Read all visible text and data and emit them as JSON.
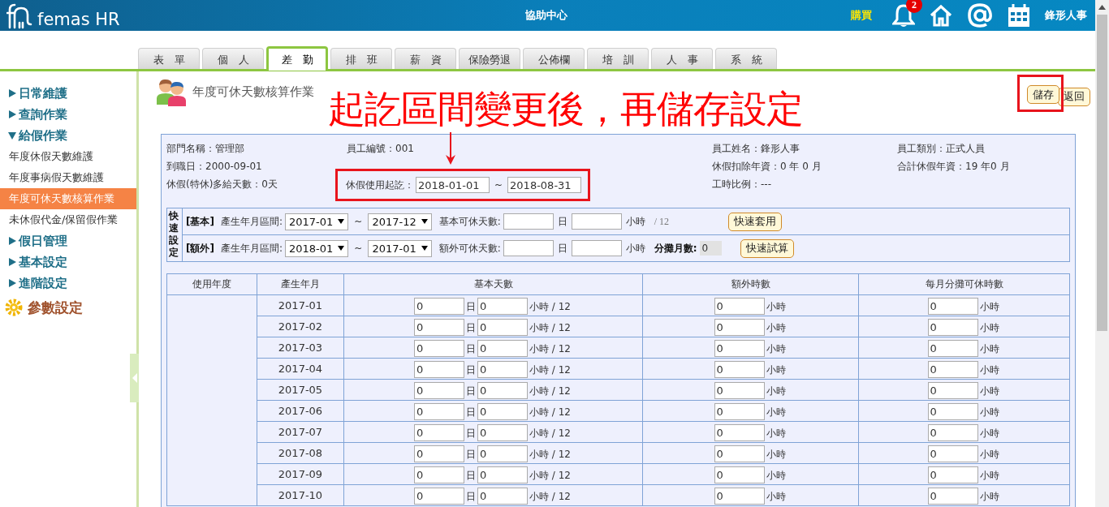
{
  "header": {
    "logo": "femas HR",
    "help": "協助中心",
    "buy": "購買",
    "notifications": "2",
    "user": "鋒形人事"
  },
  "tabs": [
    {
      "label": "表　單",
      "selected": false
    },
    {
      "label": "個　人",
      "selected": false
    },
    {
      "label": "差　勤",
      "selected": true
    },
    {
      "label": "排　班",
      "selected": false
    },
    {
      "label": "薪　資",
      "selected": false
    },
    {
      "label": "保險勞退",
      "selected": false
    },
    {
      "label": "公佈欄",
      "selected": false
    },
    {
      "label": "培　訓",
      "selected": false
    },
    {
      "label": "人　事",
      "selected": false
    },
    {
      "label": "系　統",
      "selected": false
    }
  ],
  "sidebar": {
    "items": [
      {
        "kind": "group",
        "label": "日常維護",
        "expanded": false
      },
      {
        "kind": "group",
        "label": "查詢作業",
        "expanded": false
      },
      {
        "kind": "group",
        "label": "給假作業",
        "expanded": true,
        "children": [
          {
            "label": "年度休假天數維護",
            "selected": false
          },
          {
            "label": "年度事病假天數維護",
            "selected": false
          },
          {
            "label": "年度可休天數核算作業",
            "selected": true
          },
          {
            "label": "未休假代金/保留假作業",
            "selected": false
          }
        ]
      },
      {
        "kind": "group",
        "label": "假日管理",
        "expanded": false
      },
      {
        "kind": "group",
        "label": "基本設定",
        "expanded": false
      },
      {
        "kind": "group",
        "label": "進階設定",
        "expanded": false
      },
      {
        "kind": "settings",
        "label": "參數設定"
      }
    ]
  },
  "page_title": "年度可休天數核算作業",
  "buttons": [
    "儲存",
    "返回"
  ],
  "annotation": "起訖區間變更後，再儲存設定",
  "info": {
    "columns": [
      [
        "部門名稱：管理部",
        "到職日：2000-09-01",
        "休假(特休)多給天數：0天"
      ],
      [
        "員工編號：001"
      ],
      [
        "員工姓名：鋒形人事",
        "休假扣除年資：0 年 0 月",
        "工時比例：---"
      ],
      [
        "員工類別：正式人員",
        "合計休假年資：19 年0 月"
      ]
    ],
    "date_range": {
      "label": "休假使用起訖：",
      "from": "2018-01-01",
      "sep": "~",
      "to": "2018-08-31"
    }
  },
  "quick": {
    "title": "快速設定",
    "rows": [
      {
        "kind": "basic",
        "tag": "[基本]",
        "range_label": "產生年月區間:",
        "from": "2017-01",
        "sep": "~",
        "to": "2017-12",
        "days_label": "基本可休天數:",
        "day_unit": "日",
        "hour_unit": "小時",
        "note": "/ 12",
        "button": "快速套用"
      },
      {
        "kind": "extra",
        "tag": "[額外]",
        "range_label": "產生年月區間:",
        "from": "2018-01",
        "sep": "~",
        "to": "2017-01",
        "days_label": "額外可休天數:",
        "day_unit": "日",
        "hour_unit": "小時",
        "months_label": "分攤月數:",
        "months": "0",
        "button": "快速試算"
      }
    ]
  },
  "table": {
    "columns": [
      "使用年度",
      "產生年月",
      "基本天數",
      "額外時數",
      "每月分攤可休時數"
    ],
    "rows": [
      {
        "month": "2017-01",
        "days": "0",
        "day_unit": "日",
        "hours": "0",
        "hours_unit": "小時 / 12",
        "extra": "0",
        "extra_unit": "小時",
        "monthly": "0",
        "monthly_unit": "小時"
      },
      {
        "month": "2017-02",
        "days": "0",
        "day_unit": "日",
        "hours": "0",
        "hours_unit": "小時 / 12",
        "extra": "0",
        "extra_unit": "小時",
        "monthly": "0",
        "monthly_unit": "小時"
      },
      {
        "month": "2017-03",
        "days": "0",
        "day_unit": "日",
        "hours": "0",
        "hours_unit": "小時 / 12",
        "extra": "0",
        "extra_unit": "小時",
        "monthly": "0",
        "monthly_unit": "小時"
      },
      {
        "month": "2017-04",
        "days": "0",
        "day_unit": "日",
        "hours": "0",
        "hours_unit": "小時 / 12",
        "extra": "0",
        "extra_unit": "小時",
        "monthly": "0",
        "monthly_unit": "小時"
      },
      {
        "month": "2017-05",
        "days": "0",
        "day_unit": "日",
        "hours": "0",
        "hours_unit": "小時 / 12",
        "extra": "0",
        "extra_unit": "小時",
        "monthly": "0",
        "monthly_unit": "小時"
      },
      {
        "month": "2017-06",
        "days": "0",
        "day_unit": "日",
        "hours": "0",
        "hours_unit": "小時 / 12",
        "extra": "0",
        "extra_unit": "小時",
        "monthly": "0",
        "monthly_unit": "小時"
      },
      {
        "month": "2017-07",
        "days": "0",
        "day_unit": "日",
        "hours": "0",
        "hours_unit": "小時 / 12",
        "extra": "0",
        "extra_unit": "小時",
        "monthly": "0",
        "monthly_unit": "小時"
      },
      {
        "month": "2017-08",
        "days": "0",
        "day_unit": "日",
        "hours": "0",
        "hours_unit": "小時 / 12",
        "extra": "0",
        "extra_unit": "小時",
        "monthly": "0",
        "monthly_unit": "小時"
      },
      {
        "month": "2017-09",
        "days": "0",
        "day_unit": "日",
        "hours": "0",
        "hours_unit": "小時 / 12",
        "extra": "0",
        "extra_unit": "小時",
        "monthly": "0",
        "monthly_unit": "小時"
      },
      {
        "month": "2017-10",
        "days": "0",
        "day_unit": "日",
        "hours": "0",
        "hours_unit": "小時 / 12",
        "extra": "0",
        "extra_unit": "小時",
        "monthly": "0",
        "monthly_unit": "小時"
      }
    ]
  }
}
